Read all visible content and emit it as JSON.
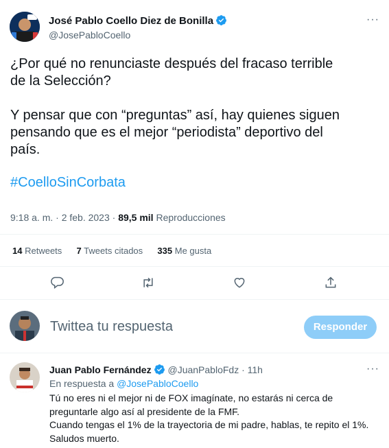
{
  "tweet": {
    "author_name": "José Pablo Coello Diez de Bonilla",
    "handle": "@JosePabloCoello",
    "text_line1": "¿Por qué no renunciaste después del fracaso terrible",
    "text_line2": "de la Selección?",
    "text_line3": "Y pensar que con “preguntas” así, hay quienes siguen",
    "text_line4": "pensando que es el mejor “periodista” deportivo del",
    "text_line5": "país.",
    "hashtag": "#CoelloSinCorbata",
    "time": "9:18 a. m. · 2 feb. 2023 ·",
    "views_count": "89,5 mil",
    "views_label": "Reproducciones",
    "retweets_count": "14",
    "retweets_label": "Retweets",
    "quotes_count": "7",
    "quotes_label": "Tweets citados",
    "likes_count": "335",
    "likes_label": "Me gusta",
    "more": "···"
  },
  "compose": {
    "placeholder": "Twittea tu respuesta",
    "button": "Responder"
  },
  "reply": {
    "author_name": "Juan Pablo Fernández",
    "handle": "@JuanPabloFdz",
    "time": "· 11h",
    "in_reply_prefix": "En respuesta a",
    "in_reply_handle": "@JosePabloCoello",
    "line1": "Tú no eres ni el mejor ni de FOX imagínate, no estarás ni cerca de",
    "line2": "preguntarle algo así al presidente de la FMF.",
    "line3": "Cuando tengas el 1% de la trayectoria de mi padre, hablas, te repito el 1%.",
    "line4": "Saludos muerto.",
    "more": "···"
  },
  "colors": {
    "accent": "#1d9bf0",
    "button_disabled": "#8ecdf8",
    "muted": "#536471"
  }
}
